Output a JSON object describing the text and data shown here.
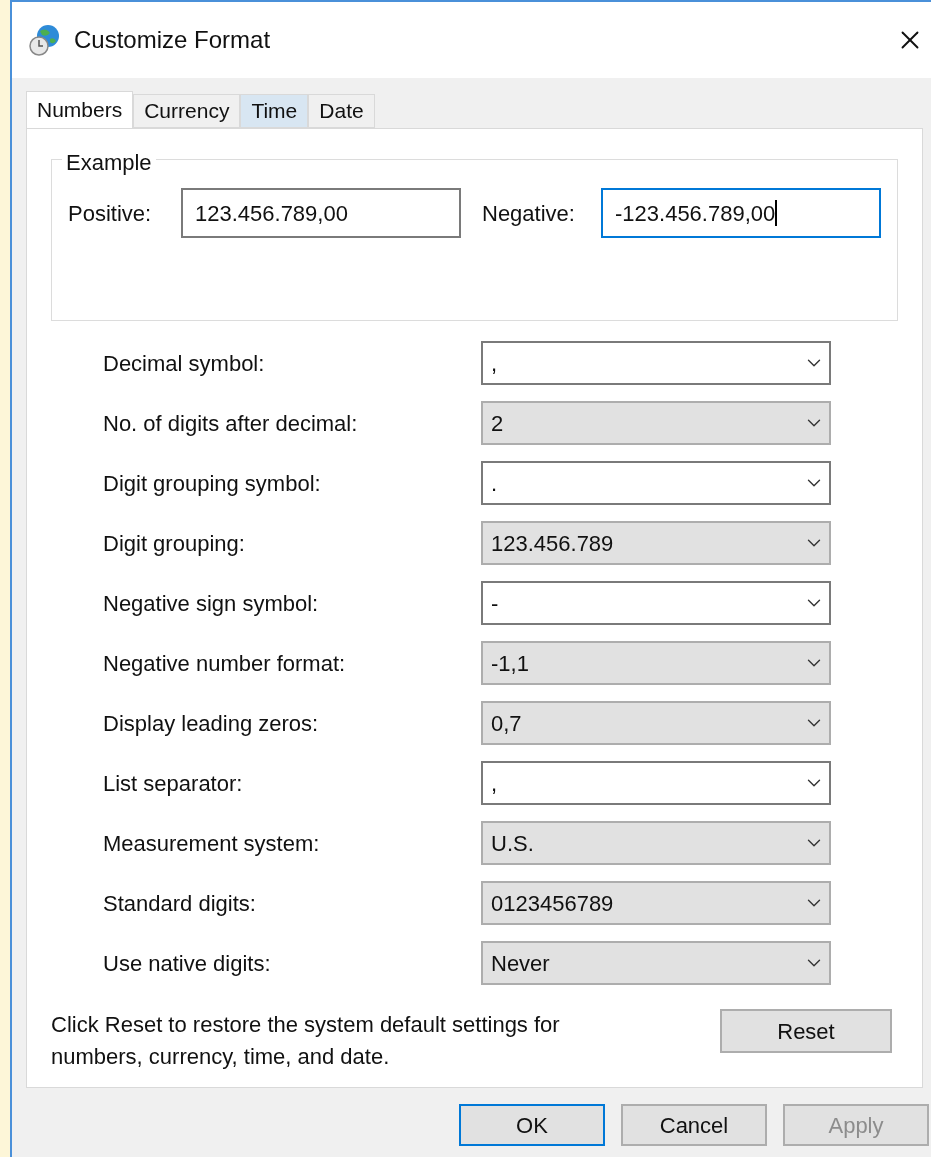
{
  "window": {
    "title": "Customize Format"
  },
  "tabs": [
    {
      "label": "Numbers",
      "selected": true,
      "hovered": false
    },
    {
      "label": "Currency",
      "selected": false,
      "hovered": false
    },
    {
      "label": "Time",
      "selected": false,
      "hovered": true
    },
    {
      "label": "Date",
      "selected": false,
      "hovered": false
    }
  ],
  "example": {
    "title": "Example",
    "positive": {
      "label": "Positive:",
      "value": "123.456.789,00",
      "focused": false
    },
    "negative": {
      "label": "Negative:",
      "value": "-123.456.789,00",
      "focused": true
    }
  },
  "settings": [
    {
      "label": "Decimal symbol:",
      "value": ",",
      "kind": "editable"
    },
    {
      "label": "No. of digits after decimal:",
      "value": "2",
      "kind": "list"
    },
    {
      "label": "Digit grouping symbol:",
      "value": ".",
      "kind": "editable"
    },
    {
      "label": "Digit grouping:",
      "value": "123.456.789",
      "kind": "list"
    },
    {
      "label": "Negative sign symbol:",
      "value": "-",
      "kind": "editable"
    },
    {
      "label": "Negative number format:",
      "value": "-1,1",
      "kind": "list"
    },
    {
      "label": "Display leading zeros:",
      "value": "0,7",
      "kind": "list"
    },
    {
      "label": "List separator:",
      "value": ",",
      "kind": "editable"
    },
    {
      "label": "Measurement system:",
      "value": "U.S.",
      "kind": "list"
    },
    {
      "label": "Standard digits:",
      "value": "0123456789",
      "kind": "list"
    },
    {
      "label": "Use native digits:",
      "value": "Never",
      "kind": "list"
    }
  ],
  "reset": {
    "note": "Click Reset to restore the system default settings for numbers, currency, time, and date.",
    "button": "Reset"
  },
  "buttons": [
    {
      "label": "OK",
      "focused": true,
      "disabled": false
    },
    {
      "label": "Cancel",
      "focused": false,
      "disabled": false
    },
    {
      "label": "Apply",
      "focused": false,
      "disabled": true
    }
  ]
}
